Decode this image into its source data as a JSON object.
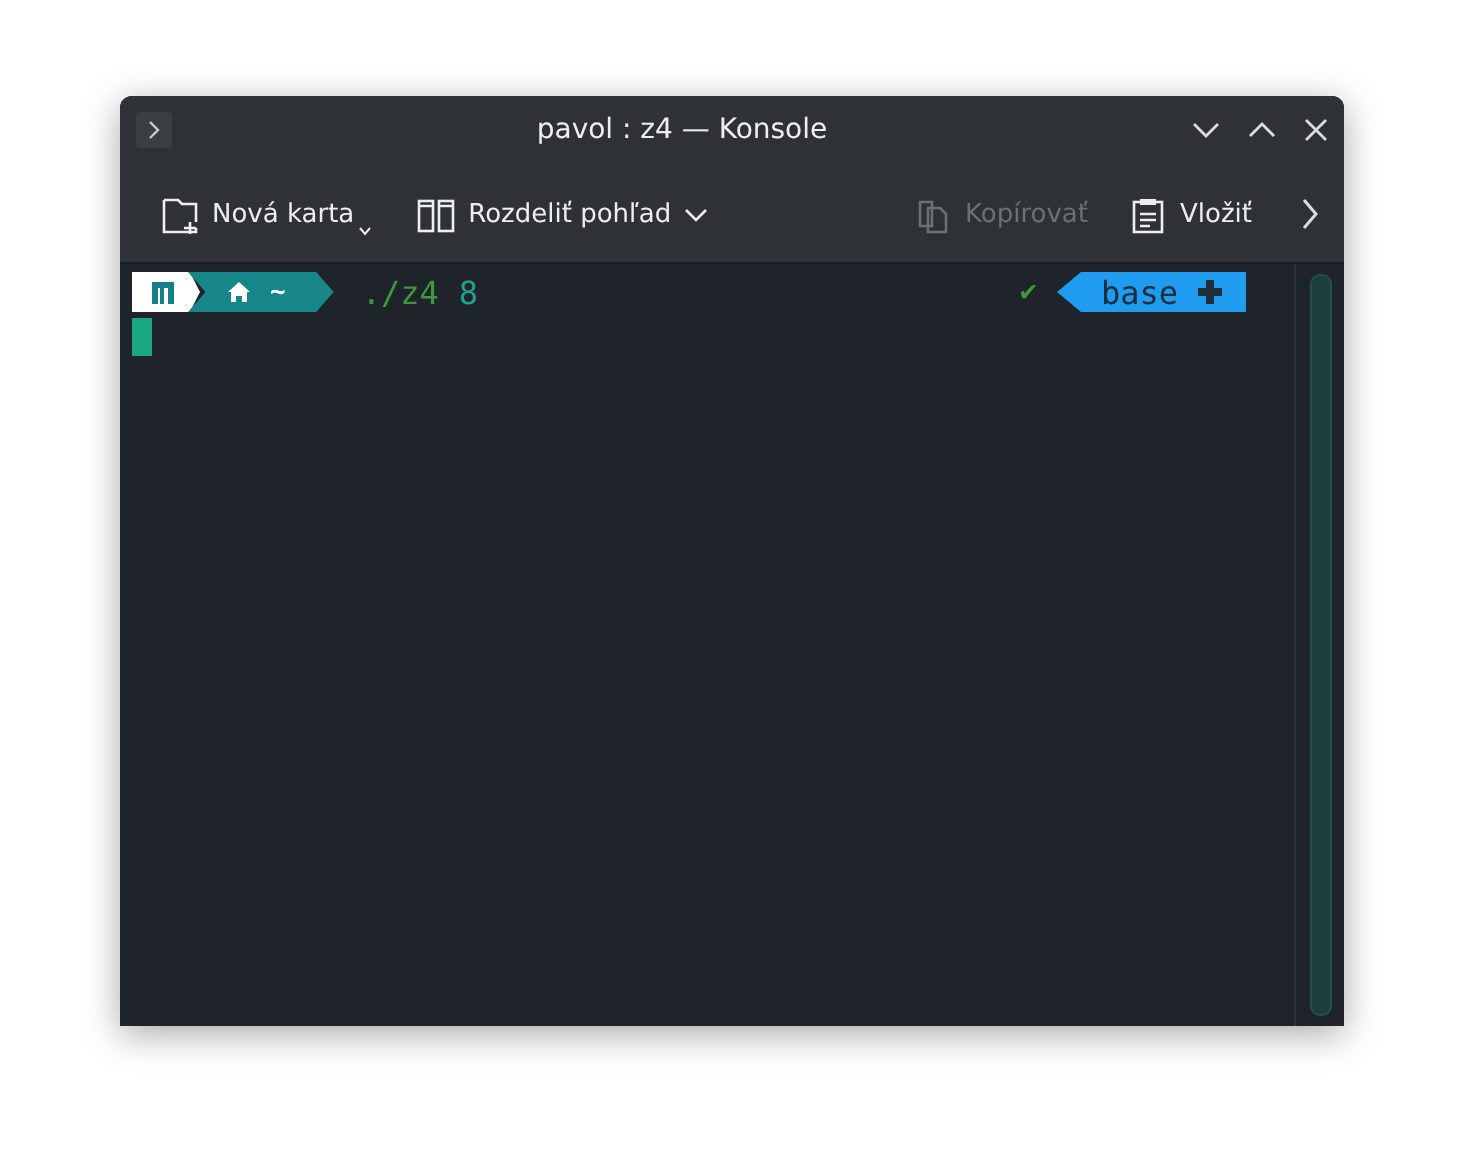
{
  "window": {
    "title": "pavol : z4 — Konsole"
  },
  "toolbar": [
    {
      "kind": "new-tab",
      "label": "Nová karta",
      "disabled": false
    },
    {
      "kind": "split",
      "label": "Rozdeliť pohľad",
      "disabled": false
    },
    {
      "kind": "copy",
      "label": "Kopírovať",
      "disabled": true
    },
    {
      "kind": "paste",
      "label": "Vložiť",
      "disabled": false
    }
  ],
  "terminal": {
    "prompt_dir": "~",
    "command": "./z4",
    "argument": "8",
    "status": "✔",
    "env": "base"
  }
}
